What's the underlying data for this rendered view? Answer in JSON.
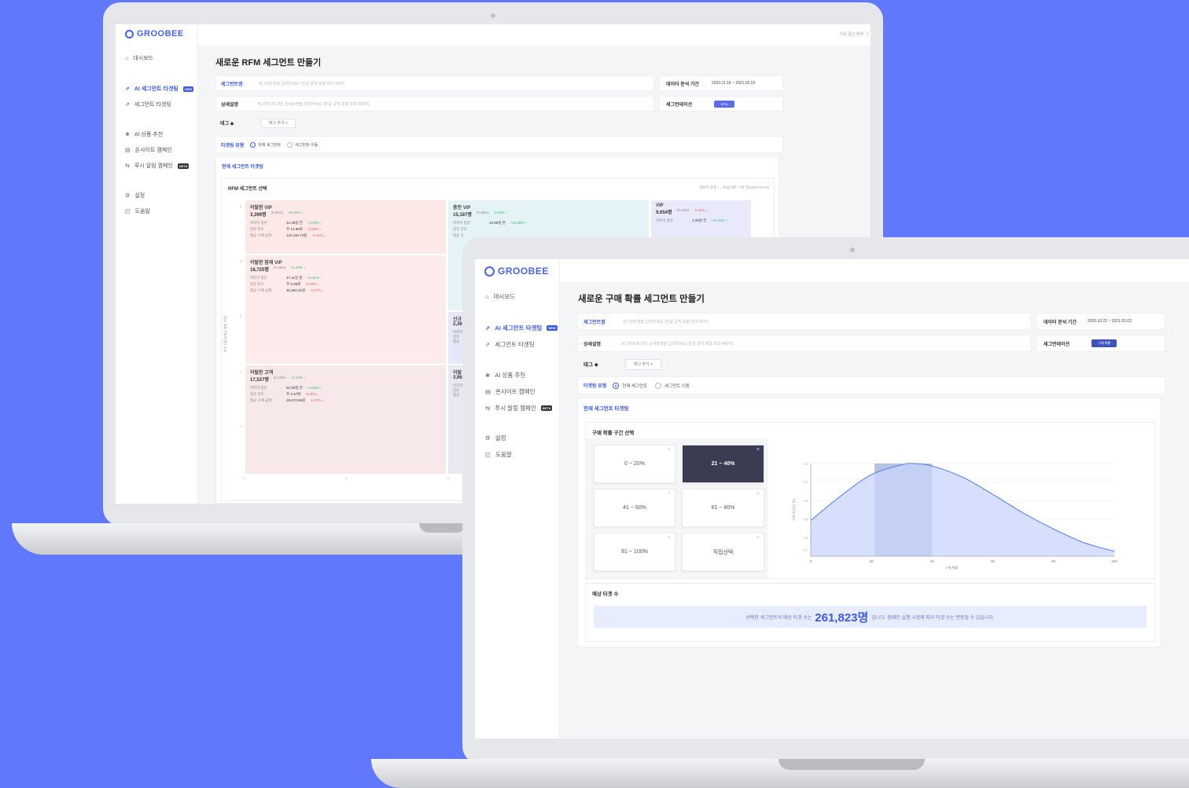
{
  "brand": "GROOBEE",
  "sidebar": {
    "dashboard": "대시보드",
    "ai_segment": "AI 세그먼트 타겟팅",
    "ai_badge": "NEW",
    "segment": "세그먼트 타겟팅",
    "ai_product": "AI 상품 추천",
    "onsite": "온사이트 캠페인",
    "push": "푸시 알림 캠페인",
    "push_badge": "BETA",
    "settings": "설정",
    "help": "도움말"
  },
  "back": {
    "topbar_text": "이용 중인 플랜 : 1",
    "title": "새로운 RFM 세그먼트 만들기",
    "seg_name_label": "세그먼트명",
    "seg_name_placeholder": "세그먼트명을 입력하세요 (한글 공백 포함 최대 40자)",
    "desc_label": "상세설명",
    "desc_placeholder": "세그먼트에 대한 상세설명을 입력하세요 (한글 공백 포함 최대 400자)",
    "period_label": "데이터 분석 기간",
    "period_value": "2020.11.16 ~ 2021.02.03",
    "segmentation_label": "세그먼테이션",
    "segmentation_chip": "RFM",
    "tag_label": "태그",
    "tag_button": "태그 추가 +",
    "targeting_label": "타겟팅 유형",
    "radio_current": "현재 세그먼트",
    "radio_move": "세그먼트 이동",
    "current_title": "현재 세그먼트 타겟팅",
    "rfm_title": "RFM 세그먼트 선택",
    "rfm_meta": "데이터 증감 ↑ ↓ 비교기준 : 7일 전(2021-01-27)",
    "y_axis": "수익 시장성(최근 방문 기준)",
    "cells": [
      {
        "name": "이탈한 VIP",
        "count": "3,399명",
        "pct": "(0.08%)",
        "chg": "+5.44% ↑",
        "r1": [
          "마지막 방문",
          "42.38일 전",
          "+4.19% ↑"
        ],
        "r2": [
          "방문 빈도",
          "주 12.85회",
          "-3.06% ↓"
        ],
        "r3": [
          "평균 구매 금액",
          "124,118.73원",
          "-4.12% ↓"
        ]
      },
      {
        "name": "충전 VIP",
        "count": "15,187명",
        "pct": "(0.38%)",
        "chg": "-0.16% ↑",
        "r1": [
          "마지막 방문",
          "10.99일 전",
          "+10.30% ↑"
        ],
        "r2": [
          "방문 빈도",
          "",
          ""
        ],
        "r3": [
          "평균 구",
          "",
          ""
        ]
      },
      {
        "name": "VIP",
        "count": "9,654명",
        "pct": "(0.24%)",
        "chg": "-0.40% ↓",
        "r1": [
          "마지막 방문",
          "1.28일 전",
          "+11.02% ↑"
        ],
        "r2": [
          "",
          "",
          ""
        ],
        "r3": [
          "",
          "",
          ""
        ]
      },
      {
        "name": "이탈한 잠재 VIP",
        "count": "18,725명",
        "pct": "(0.46%)",
        "chg": "+1.43% ↑",
        "r1": [
          "마지막 방문",
          "47.11일 전",
          "+0.41% ↑"
        ],
        "r2": [
          "방문 빈도",
          "주 5.09회",
          "-6.78% ↓"
        ],
        "r3": [
          "평균 구매 금액",
          "46,302.31원",
          "-1.07% ↓"
        ]
      },
      {
        "name": "이탈한 고객",
        "count": "17,537명",
        "pct": "(0.43%)",
        "chg": "+1.12% ↑",
        "r1": [
          "마지막 방문",
          "52.59일 전",
          "+4.62% ↑"
        ],
        "r2": [
          "방문 빈도",
          "주 2.47회",
          "-0.40% ↓"
        ],
        "r3": [
          "평균 구매 금액",
          "26,672.55원",
          "-1.37% ↓"
        ]
      },
      {
        "name": "신규",
        "count": "2,36",
        "pct": "",
        "chg": "",
        "r1": [
          "마지막",
          "",
          ""
        ],
        "r2": [
          "방문",
          "",
          ""
        ],
        "r3": [
          "평균",
          "",
          ""
        ]
      },
      {
        "name": "이탈",
        "count": "3,96",
        "pct": "",
        "chg": "",
        "r1": [
          "마지막",
          "",
          ""
        ],
        "r2": [
          "방문",
          "",
          ""
        ],
        "r3": [
          "평균",
          "",
          ""
        ]
      }
    ],
    "y_ticks": [
      "5",
      "4",
      "3",
      "2",
      "1"
    ],
    "x_ticks": [
      "0",
      "1",
      "2"
    ]
  },
  "front": {
    "title": "새로운 구매 확률 세그먼트 만들기",
    "seg_name_label": "세그먼트명",
    "seg_name_placeholder": "세그먼트명을 입력하세요 (한글 공백 포함 최대 40자)",
    "desc_label": "상세설명",
    "desc_placeholder": "세그먼트에 대한 상세설명을 입력하세요 (한글 공백 포함 최대 400자)",
    "period_label": "데이터 분석 기간",
    "period_value": "2020.10.22 ~ 2021.02.03",
    "segmentation_label": "세그먼테이션",
    "segmentation_chip": "구매 확률",
    "tag_label": "태그",
    "tag_button": "태그 추가 +",
    "targeting_label": "타겟팅 유형",
    "radio_current": "현재 세그먼트",
    "radio_move": "세그먼트 이동",
    "current_title": "현재 세그먼트 타겟팅",
    "prob_title": "구매 확률 구간 선택",
    "ranges": [
      "0 ~ 20%",
      "21 ~ 40%",
      "41 ~ 60%",
      "61 ~ 80%",
      "81 ~ 100%",
      "직접선택"
    ],
    "selected_range": "21 ~ 40%",
    "estimate_title": "예상 타겟 수",
    "est_prefix": "선택한 세그먼트의 예상 타겟 수는",
    "est_value": "261,823명",
    "est_suffix": "입니다. 캠페인 실행 시점에 따라 타겟 수는 변동될 수 있습니다."
  },
  "chart_data": {
    "type": "area",
    "xlabel": "구매 확률",
    "ylabel": "고객 수(단위: 만)",
    "xlim": [
      0,
      100
    ],
    "ylim": [
      0,
      1.5
    ],
    "x_ticks": [
      0,
      20,
      40,
      60,
      80,
      100
    ],
    "y_ticks": [
      0.1,
      0.3,
      0.6,
      0.9,
      1.2,
      1.5
    ],
    "highlight_range": [
      21,
      40
    ],
    "x": [
      0,
      10,
      20,
      30,
      34,
      40,
      50,
      60,
      70,
      80,
      90,
      100
    ],
    "y": [
      0.58,
      0.98,
      1.32,
      1.48,
      1.5,
      1.46,
      1.28,
      1.0,
      0.7,
      0.44,
      0.22,
      0.08
    ],
    "colors": {
      "fill": "#c8d6fb",
      "line": "#5f82e8",
      "highlight": "#a9b7dd"
    }
  }
}
